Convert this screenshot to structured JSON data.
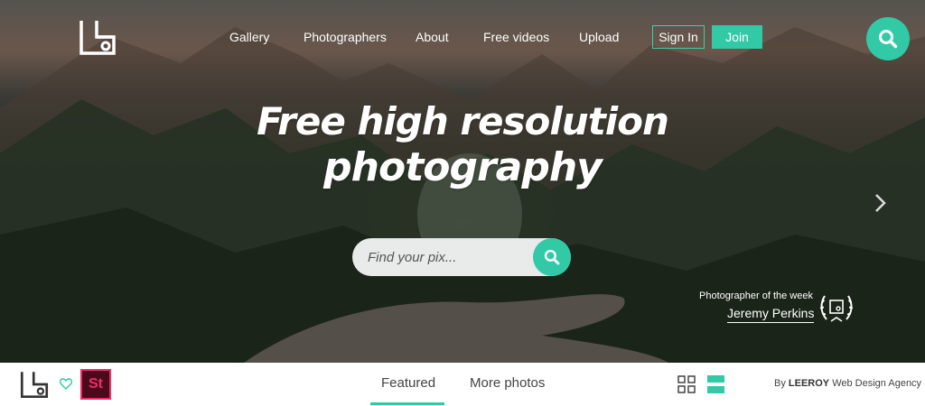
{
  "nav": {
    "items": [
      {
        "label": "Gallery"
      },
      {
        "label": "Photographers"
      },
      {
        "label": "About"
      },
      {
        "label": "Free videos"
      },
      {
        "label": "Upload"
      }
    ],
    "sign_in": "Sign In",
    "join": "Join"
  },
  "hero": {
    "headline_line1": "Free high resolution",
    "headline_line2": "photography",
    "search_placeholder": "Find your pix..."
  },
  "photographer_of_week": {
    "label": "Photographer of the week",
    "name": "Jeremy Perkins"
  },
  "bottom": {
    "tabs": [
      {
        "label": "Featured",
        "active": true
      },
      {
        "label": "More photos",
        "active": false
      }
    ],
    "stock_badge": "St",
    "credit_prefix": "By",
    "credit_brand": "LEEROY",
    "credit_suffix": "Web Design Agency"
  },
  "icons": {
    "logo": "logo-icon",
    "search": "search-icon",
    "next": "chevron-right-icon",
    "laurel": "laurel-badge-icon",
    "heart": "heart-icon",
    "grid_view": "grid-view-icon",
    "list_view": "list-view-icon"
  },
  "colors": {
    "accent": "#32c9a7",
    "stock_bg": "#4b0a1c",
    "stock_fg": "#ef2c6a"
  }
}
